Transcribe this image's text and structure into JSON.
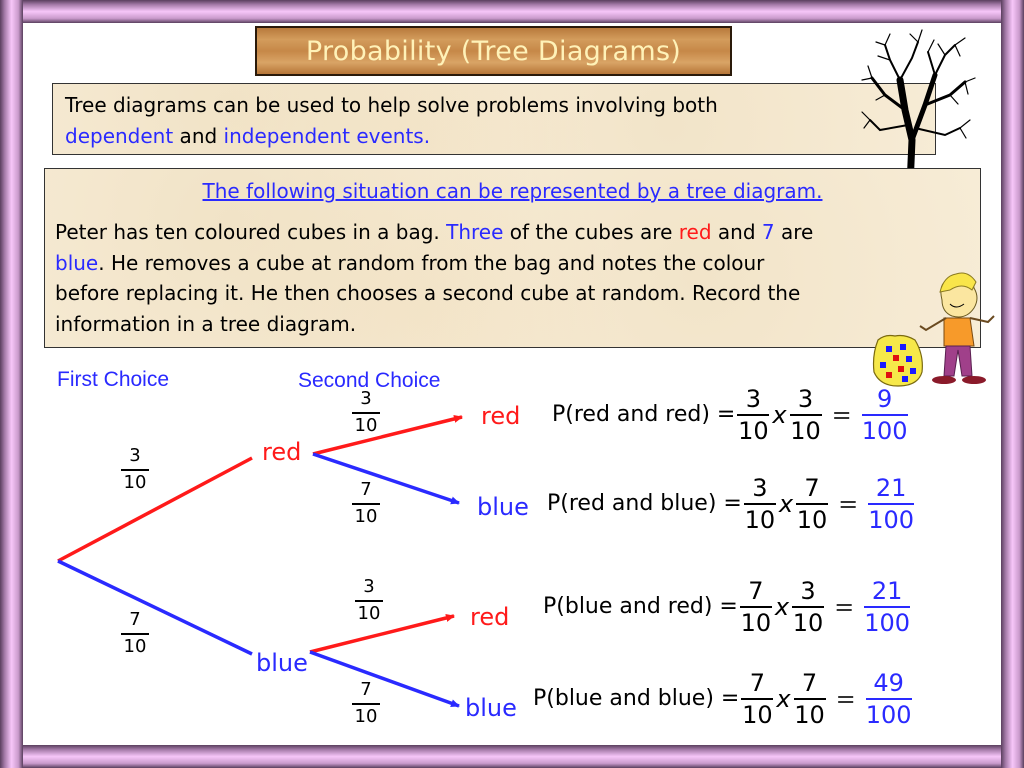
{
  "title": "Probability (Tree Diagrams)",
  "intro": {
    "line1": "Tree diagrams can be used to help solve problems involving both",
    "dependent": "dependent",
    "and": " and ",
    "independent": "independent events."
  },
  "situation": {
    "heading": "The following situation can be represented by a tree diagram.",
    "p1": "Peter has ten coloured cubes in a bag. ",
    "three": "Three",
    "p2": " of the cubes are ",
    "red": "red",
    "p3": " and ",
    "seven": "7",
    "p4": " are",
    "blue": "blue",
    "p5": ". He removes a cube at random from the bag and notes the colour",
    "p6": "before replacing it. He then chooses a second cube at random. Record the",
    "p7": "information in a tree diagram."
  },
  "tree": {
    "first_choice_label": "First Choice",
    "second_choice_label": "Second Choice",
    "colors": {
      "red": "#ff1a1a",
      "blue": "#2a2aff"
    },
    "first": [
      {
        "outcome": "red",
        "num": "3",
        "den": "10"
      },
      {
        "outcome": "blue",
        "num": "7",
        "den": "10"
      }
    ],
    "second": [
      {
        "from": "red",
        "outcome": "red",
        "num": "3",
        "den": "10"
      },
      {
        "from": "red",
        "outcome": "blue",
        "num": "7",
        "den": "10"
      },
      {
        "from": "blue",
        "outcome": "red",
        "num": "3",
        "den": "10"
      },
      {
        "from": "blue",
        "outcome": "blue",
        "num": "7",
        "den": "10"
      }
    ]
  },
  "equations": [
    {
      "label": "P(red and red) =",
      "a_num": "3",
      "a_den": "10",
      "times": "x",
      "b_num": "3",
      "b_den": "10",
      "eq": "=",
      "r_num": "9",
      "r_den": "100"
    },
    {
      "label": "P(red and blue) =",
      "a_num": "3",
      "a_den": "10",
      "times": "x",
      "b_num": "7",
      "b_den": "10",
      "eq": "=",
      "r_num": "21",
      "r_den": "100"
    },
    {
      "label": "P(blue and red) =",
      "a_num": "7",
      "a_den": "10",
      "times": "x",
      "b_num": "3",
      "b_den": "10",
      "eq": "=",
      "r_num": "21",
      "r_den": "100"
    },
    {
      "label": "P(blue and blue) =",
      "a_num": "7",
      "a_den": "10",
      "times": "x",
      "b_num": "7",
      "b_den": "10",
      "eq": "=",
      "r_num": "49",
      "r_den": "100"
    }
  ],
  "illustrations": {
    "tree_icon": "bare-tree-icon",
    "boy_icon": "boy-cartoon-icon",
    "bag_icon": "bag-of-cubes-icon"
  }
}
